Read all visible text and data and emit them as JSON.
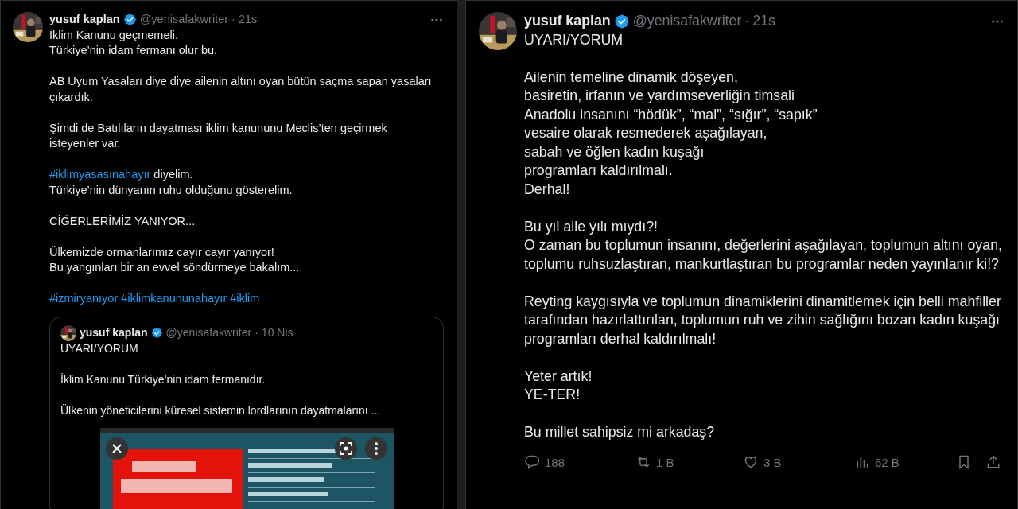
{
  "tweets": [
    {
      "author": {
        "name": "yusuf kaplan",
        "handle": "@yenisafakwriter",
        "separator": "·",
        "time": "21s"
      },
      "paragraphs": [
        "İklim Kanunu geçmemeli.\nTürkiye’nin idam fermanı olur bu.",
        "AB Uyum Yasaları diye diye ailenin altını oyan bütün saçma sapan yasaları çıkardık.",
        "Şimdi de Batılıların dayatması iklim kanununu Meclis’ten geçirmek isteyenler var.",
        [
          {
            "kind": "hashtag",
            "text": "#iklimyasasınahayır"
          },
          {
            "kind": "text",
            "text": " diyelim.\nTürkiye’nin dünyanın ruhu olduğunu gösterelim."
          }
        ],
        "CİĞERLERİMİZ YANIYOR...",
        "Ülkemizde ormanlarımız cayır cayır yanıyor!\nBu yangınları bir an evvel söndürmeye bakalım...",
        {
          "hashtags": [
            "#izmiryanıyor",
            "#iklimkanununahayır",
            "#iklim"
          ]
        }
      ],
      "quote": {
        "author": {
          "name": "yusuf kaplan",
          "handle": "@yenisafakwriter",
          "separator": "·",
          "time": "10 Nis"
        },
        "paragraphs": [
          "UYARI/YORUM",
          "İklim Kanunu Türkiye’nin idam fermanıdır.",
          "Ülkenin yöneticilerini küresel sistemin lordlarının dayatmalarını ..."
        ]
      }
    },
    {
      "author": {
        "name": "yusuf kaplan",
        "handle": "@yenisafakwriter",
        "separator": "·",
        "time": "21s"
      },
      "paragraphs": [
        "UYARI/YORUM",
        "Ailenin temeline dinamik döşeyen,\nbasiretin, irfanın ve yardımseverliğin timsali\nAnadolu insanını “hödük”, “mal”, “sığır”, “sapık”\nvesaire olarak resmederek aşağılayan,\nsabah ve öğlen kadın kuşağı\nprogramları kaldırılmalı.\nDerhal!",
        "Bu yıl aile yılı mıydı?!\nO zaman bu toplumun insanını, değerlerini aşağılayan, toplumun altını oyan, toplumu ruhsuzlaştıran, mankurtlaştıran bu programlar neden yayınlanır ki!?",
        "Reyting kaygısıyla ve toplumun dinamiklerini dinamitlemek için belli mahfiller tarafından hazırlattırılan, toplumun ruh ve zihin sağlığını bozan kadın kuşağı programları derhal kaldırılmalı!",
        "Yeter artık!\nYE-TER!",
        "Bu millet sahipsiz mi arkadaş?"
      ],
      "actions": [
        {
          "kind": "reply",
          "count": "188"
        },
        {
          "kind": "retweet",
          "count": "1 B"
        },
        {
          "kind": "like",
          "count": "3 B"
        },
        {
          "kind": "views",
          "count": "62 B"
        },
        {
          "kind": "bookmark"
        },
        {
          "kind": "share"
        }
      ]
    }
  ]
}
